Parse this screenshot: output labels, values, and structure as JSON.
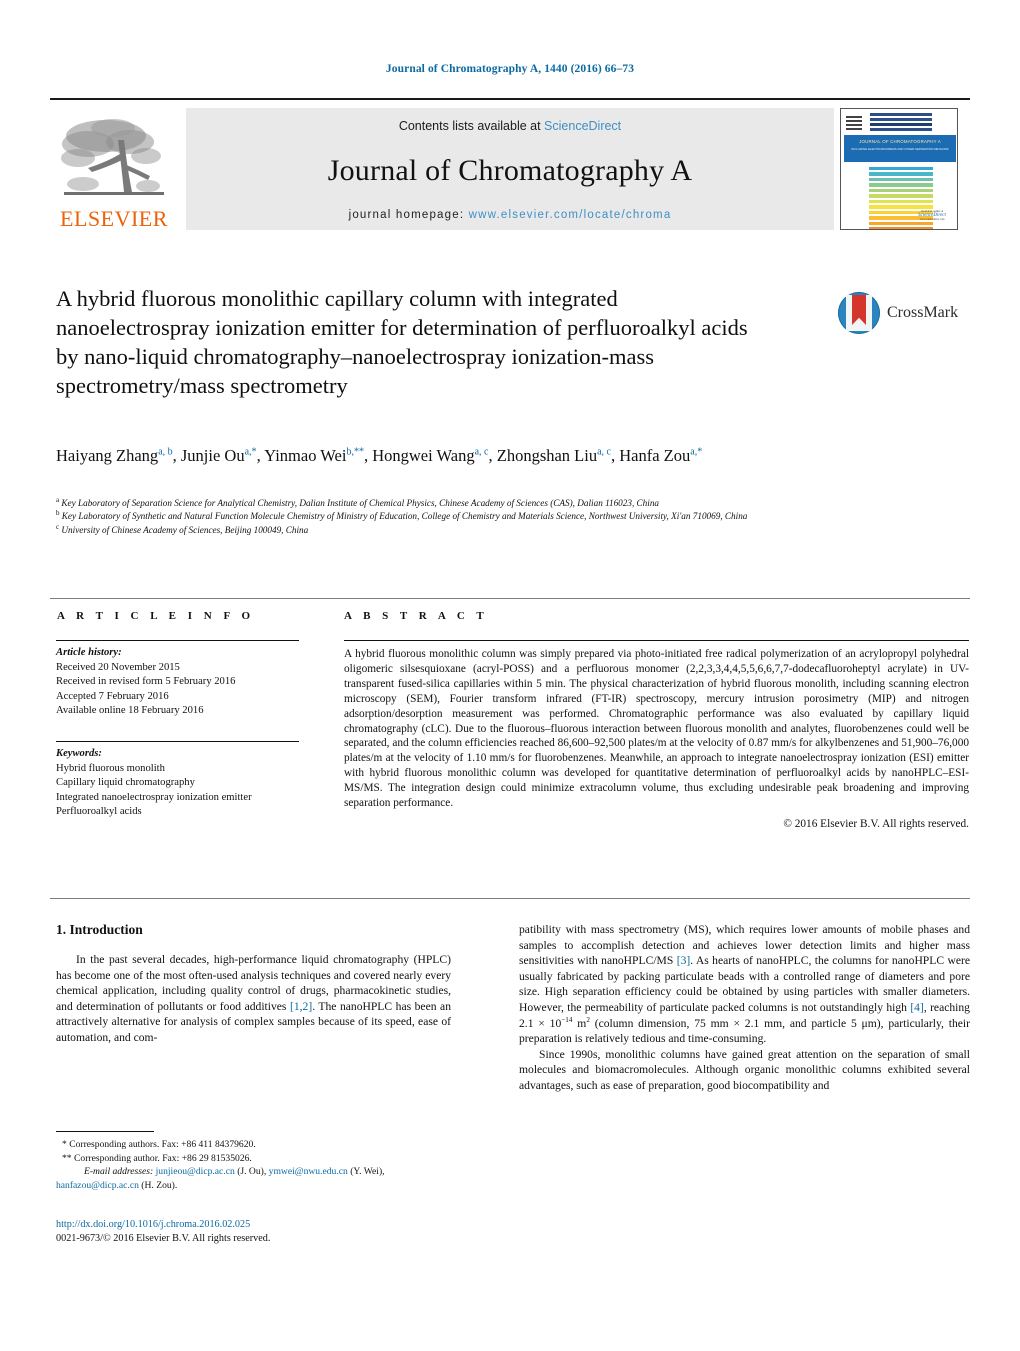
{
  "running_head": "Journal of Chromatography A, 1440 (2016) 66–73",
  "masthead": {
    "contents_prefix": "Contents lists available at ",
    "sciencedirect": "ScienceDirect",
    "journal_title": "Journal of Chromatography A",
    "homepage_prefix": "journal homepage: ",
    "homepage_url": "www.elsevier.com/locate/chroma",
    "publisher": "ELSEVIER",
    "cover": {
      "banner_title": "JOURNAL OF CHROMATOGRAPHY A",
      "banner_sub": "INCLUDING ELECTROPHORESIS AND OTHER SEPARATION METHODS",
      "foot_line1": "Available online at",
      "foot_line2": "ScienceDirect",
      "foot_line3": "www.sciencedirect.com"
    }
  },
  "article": {
    "title": "A hybrid fluorous monolithic capillary column with integrated nanoelectrospray ionization emitter for determination of perfluoroalkyl acids by nano-liquid chromatography–nanoelectrospray ionization-mass spectrometry/mass spectrometry",
    "crossmark_label": "CrossMark",
    "authors_html": "Haiyang Zhang<sup>a, b</sup>, Junjie Ou<sup>a,*</sup>, Yinmao Wei<sup>b,**</sup>, Hongwei Wang<sup>a, c</sup>, Zhongshan Liu<sup>a, c</sup>, Hanfa Zou<sup>a,*</sup>",
    "affiliations": [
      "a Key Laboratory of Separation Science for Analytical Chemistry, Dalian Institute of Chemical Physics, Chinese Academy of Sciences (CAS), Dalian 116023, China",
      "b Key Laboratory of Synthetic and Natural Function Molecule Chemistry of Ministry of Education, College of Chemistry and Materials Science, Northwest University, Xi'an 710069, China",
      "c University of Chinese Academy of Sciences, Beijing 100049, China"
    ]
  },
  "article_info": {
    "heading": "A R T I C L E   I N F O",
    "history_label": "Article history:",
    "history": [
      "Received 20 November 2015",
      "Received in revised form 5 February 2016",
      "Accepted 7 February 2016",
      "Available online 18 February 2016"
    ],
    "keywords_label": "Keywords:",
    "keywords": [
      "Hybrid fluorous monolith",
      "Capillary liquid chromatography",
      "Integrated nanoelectrospray ionization emitter",
      "Perfluoroalkyl acids"
    ]
  },
  "abstract": {
    "heading": "A B S T R A C T",
    "text": "A hybrid fluorous monolithic column was simply prepared via photo-initiated free radical polymerization of an acrylopropyl polyhedral oligomeric silsesquioxane (acryl-POSS) and a perfluorous monomer (2,2,3,3,4,4,5,5,6,6,7,7-dodecafluoroheptyl acrylate) in UV-transparent fused-silica capillaries within 5 min. The physical characterization of hybrid fluorous monolith, including scanning electron microscopy (SEM), Fourier transform infrared (FT-IR) spectroscopy, mercury intrusion porosimetry (MIP) and nitrogen adsorption/desorption measurement was performed. Chromatographic performance was also evaluated by capillary liquid chromatography (cLC). Due to the fluorous–fluorous interaction between fluorous monolith and analytes, fluorobenzenes could well be separated, and the column efficiencies reached 86,600–92,500 plates/m at the velocity of 0.87 mm/s for alkylbenzenes and 51,900–76,000 plates/m at the velocity of 1.10 mm/s for fluorobenzenes. Meanwhile, an approach to integrate nanoelectrospray ionization (ESI) emitter with hybrid fluorous monolithic column was developed for quantitative determination of perfluoroalkyl acids by nanoHPLC–ESI-MS/MS. The integration design could minimize extracolumn volume, thus excluding undesirable peak broadening and improving separation performance.",
    "copyright": "© 2016 Elsevier B.V. All rights reserved."
  },
  "body": {
    "section_title": "1.  Introduction",
    "left_p1_a": "In the past several decades, high-performance liquid chromatography (HPLC) has become one of the most often-used analysis techniques and covered nearly every chemical application, including quality control of drugs, pharmacokinetic studies, and determination of pollutants or food additives ",
    "left_ref_1": "[1,2]",
    "left_p1_b": ". The nanoHPLC has been an attractively alternative for analysis of complex samples because of its speed, ease of automation, and com-",
    "right_p1_a": "patibility with mass spectrometry (MS), which requires lower amounts of mobile phases and samples to accomplish detection and achieves lower detection limits and higher mass sensitivities with nanoHPLC/MS ",
    "right_ref_3": "[3]",
    "right_p1_b": ". As hearts of nanoHPLC, the columns for nanoHPLC were usually fabricated by packing particulate beads with a controlled range of diameters and pore size. High separation efficiency could be obtained by using particles with smaller diameters. However, the permeability of particulate packed columns is not outstandingly high ",
    "right_ref_4": "[4]",
    "right_p1_c": ", reaching 2.1 × 10",
    "right_p1_exp": "−14",
    "right_p1_d": " m",
    "right_p1_exp2": "2",
    "right_p1_e": " (column dimension, 75 mm × 2.1 mm, and particle 5 μm), particularly, their preparation is relatively tedious and time-consuming.",
    "right_p2": "Since 1990s, monolithic columns have gained great attention on the separation of small molecules and biomacromolecules. Although organic monolithic columns exhibited several advantages, such as ease of preparation, good biocompatibility and"
  },
  "footnotes": {
    "star1": "*  Corresponding authors. Fax: +86 411 84379620.",
    "star2": "**  Corresponding author. Fax: +86 29 81535026.",
    "email_label": "E-mail addresses:",
    "email1": "junjieou@dicp.ac.cn",
    "email1_who": "(J. Ou),",
    "email2": "ymwei@nwu.edu.cn",
    "email2_who": "(Y. Wei),",
    "email3": "hanfazou@dicp.ac.cn",
    "email3_who": "(H. Zou)."
  },
  "doi_block": {
    "doi": "http://dx.doi.org/10.1016/j.chroma.2016.02.025",
    "issn": "0021-9673/© 2016 Elsevier B.V. All rights reserved."
  },
  "colors": {
    "link": "#0b6aa2",
    "sciencedirect": "#3f8fc4",
    "elsevier_orange": "#eb6209",
    "masthead_bg": "#e9e9e9"
  }
}
